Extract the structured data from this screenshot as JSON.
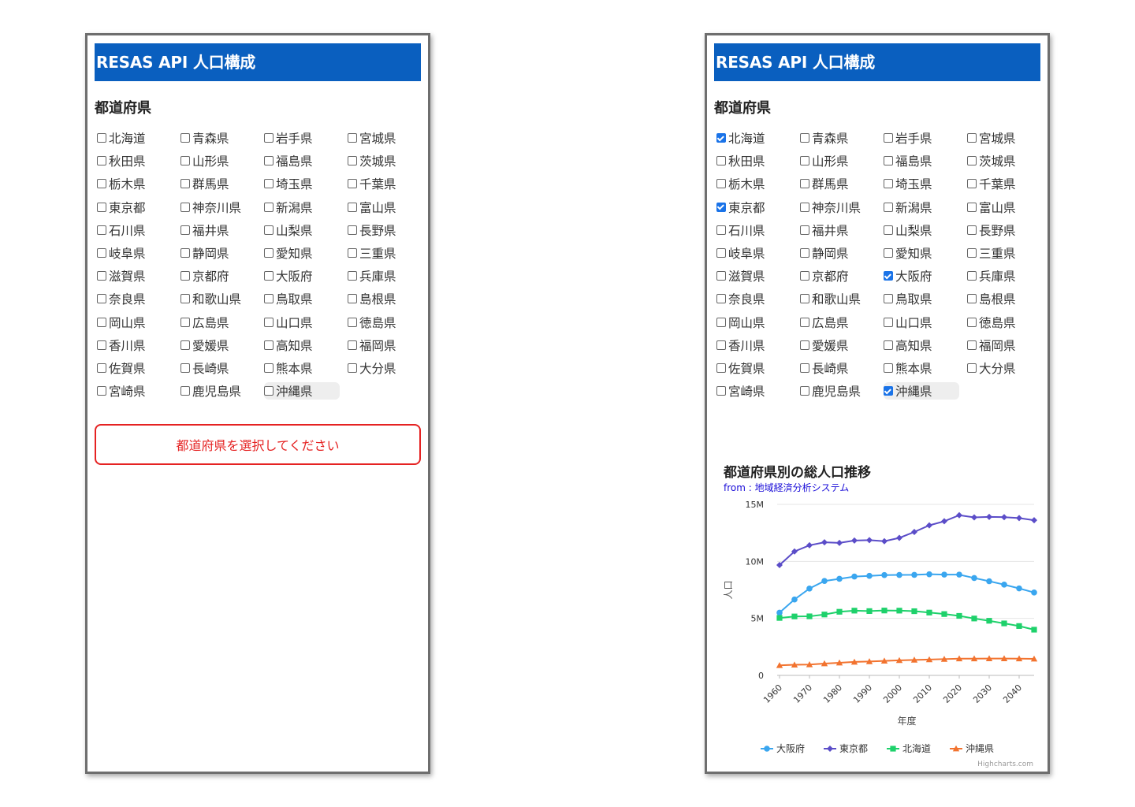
{
  "app": {
    "title": "RESAS API 人口構成",
    "section_title": "都道府県"
  },
  "prefectures": [
    "北海道",
    "青森県",
    "岩手県",
    "宮城県",
    "秋田県",
    "山形県",
    "福島県",
    "茨城県",
    "栃木県",
    "群馬県",
    "埼玉県",
    "千葉県",
    "東京都",
    "神奈川県",
    "新潟県",
    "富山県",
    "石川県",
    "福井県",
    "山梨県",
    "長野県",
    "岐阜県",
    "静岡県",
    "愛知県",
    "三重県",
    "滋賀県",
    "京都府",
    "大阪府",
    "兵庫県",
    "奈良県",
    "和歌山県",
    "鳥取県",
    "島根県",
    "岡山県",
    "広島県",
    "山口県",
    "徳島県",
    "香川県",
    "愛媛県",
    "高知県",
    "福岡県",
    "佐賀県",
    "長崎県",
    "熊本県",
    "大分県",
    "宮崎県",
    "鹿児島県",
    "沖縄県"
  ],
  "left_view": {
    "checked": [],
    "hovered": "沖縄県",
    "alert": "都道府県を選択してください"
  },
  "right_view": {
    "checked": [
      "北海道",
      "東京都",
      "大阪府",
      "沖縄県"
    ],
    "hovered": "沖縄県"
  },
  "chart_data": {
    "type": "line",
    "title": "都道府県別の総人口推移",
    "subtitle": "from : 地域経済分析システム",
    "xlabel": "年度",
    "ylabel": "人口",
    "credits": "Highcharts.com",
    "ylim": [
      0,
      15000000
    ],
    "yticks": [
      "0",
      "5M",
      "10M",
      "15M"
    ],
    "ytick_values": [
      0,
      5000000,
      10000000,
      15000000
    ],
    "xtick_labels": [
      "1960",
      "1970",
      "1980",
      "1990",
      "2000",
      "2010",
      "2020",
      "2030",
      "2040"
    ],
    "x": [
      1960,
      1965,
      1970,
      1975,
      1980,
      1985,
      1990,
      1995,
      2000,
      2005,
      2010,
      2015,
      2020,
      2025,
      2030,
      2035,
      2040,
      2045
    ],
    "grid": true,
    "legend_position": "bottom-center",
    "series": [
      {
        "name": "大阪府",
        "color": "#3aa6ef",
        "marker": "circle",
        "values": [
          5500000,
          6660000,
          7620000,
          8280000,
          8470000,
          8670000,
          8730000,
          8800000,
          8810000,
          8820000,
          8870000,
          8840000,
          8840000,
          8540000,
          8260000,
          7960000,
          7630000,
          7270000
        ]
      },
      {
        "name": "東京都",
        "color": "#5b4dc8",
        "marker": "diamond",
        "values": [
          9680000,
          10870000,
          11410000,
          11670000,
          11620000,
          11830000,
          11860000,
          11770000,
          12060000,
          12580000,
          13160000,
          13520000,
          14050000,
          13860000,
          13900000,
          13880000,
          13800000,
          13610000
        ]
      },
      {
        "name": "北海道",
        "color": "#1ed16b",
        "marker": "square",
        "values": [
          5040000,
          5170000,
          5180000,
          5340000,
          5580000,
          5680000,
          5640000,
          5690000,
          5680000,
          5630000,
          5510000,
          5380000,
          5220000,
          4990000,
          4790000,
          4560000,
          4330000,
          4010000
        ]
      },
      {
        "name": "沖縄県",
        "color": "#f2732f",
        "marker": "triangle",
        "values": [
          880000,
          930000,
          950000,
          1040000,
          1110000,
          1180000,
          1220000,
          1270000,
          1320000,
          1360000,
          1390000,
          1430000,
          1470000,
          1470000,
          1480000,
          1480000,
          1470000,
          1450000
        ]
      }
    ]
  }
}
